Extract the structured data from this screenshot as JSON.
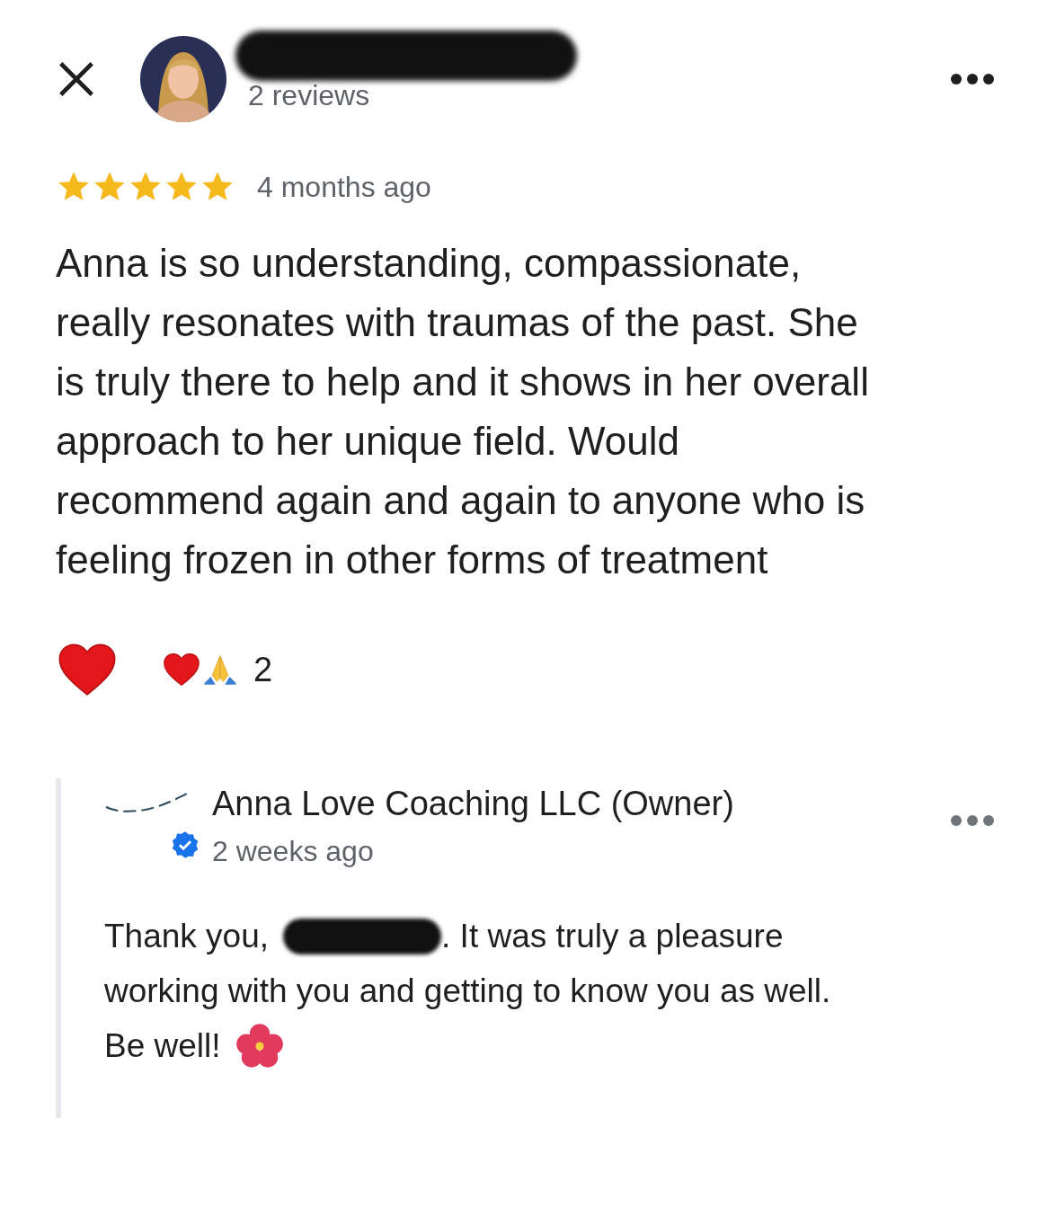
{
  "review": {
    "reviews_count": "2 reviews",
    "stars": 5,
    "time": "4 months ago",
    "text": "Anna is so understanding, compassionate, really resonates with traumas of the past. She is truly there to help and it shows in her overall approach to her unique field. Would recommend again and again to anyone who is feeling frozen in other forms of treatment",
    "reaction_count": "2"
  },
  "owner_reply": {
    "name": "Anna Love Coaching LLC (Owner)",
    "verified": true,
    "time": "2 weeks ago",
    "text_before": "Thank you,",
    "text_after": ". It was truly a pleasure",
    "text_line_2": "working with you and getting to know you as well.",
    "text_line_3": "Be well!"
  }
}
